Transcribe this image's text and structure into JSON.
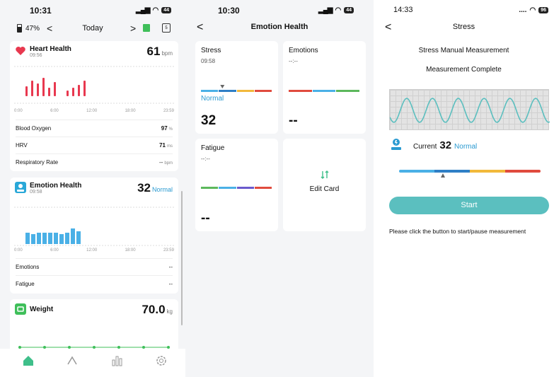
{
  "phone1": {
    "status": {
      "time": "10:31",
      "battery": "44"
    },
    "nav": {
      "battery_pct": "47%",
      "prev": "<",
      "title": "Today",
      "next": ">",
      "cal_day": "5"
    },
    "heart": {
      "title": "Heart Health",
      "time": "09:56",
      "value": "61",
      "unit": "bpm",
      "bars": [
        14,
        22,
        18,
        26,
        12,
        20,
        8,
        12,
        16,
        22
      ],
      "time_labels": [
        "0:00",
        "6:00",
        "12:00",
        "18:00",
        "23:59"
      ],
      "rows": [
        {
          "label": "Blood Oxygen",
          "value": "97",
          "unit": "%"
        },
        {
          "label": "HRV",
          "value": "71",
          "unit": "ms"
        },
        {
          "label": "Respiratory Rate",
          "value": "--",
          "unit": "bpm"
        }
      ]
    },
    "emotion": {
      "title": "Emotion Health",
      "time": "09:58",
      "value": "32",
      "status": "Normal",
      "bars": [
        16,
        14,
        16,
        16,
        16,
        16,
        14,
        16,
        22,
        18
      ],
      "time_labels": [
        "0:00",
        "6:00",
        "12:00",
        "18:00",
        "23:59"
      ],
      "rows": [
        {
          "label": "Emotions",
          "value": "--"
        },
        {
          "label": "Fatigue",
          "value": "--"
        }
      ]
    },
    "weight": {
      "title": "Weight",
      "value": "70.0",
      "unit": "kg"
    },
    "tabs": [
      "home-icon",
      "activity-icon",
      "stats-icon",
      "settings-icon"
    ]
  },
  "phone2": {
    "status": {
      "time": "10:30",
      "battery": "44"
    },
    "header": {
      "back": "<",
      "title": "Emotion Health"
    },
    "tiles": {
      "stress": {
        "title": "Stress",
        "time": "09:58",
        "status": "Normal",
        "value": "32",
        "level": 0.3
      },
      "emotions": {
        "title": "Emotions",
        "time": "--:--",
        "value": "--"
      },
      "fatigue": {
        "title": "Fatigue",
        "time": "--:--",
        "value": "--"
      },
      "edit": {
        "label": "Edit Card"
      }
    }
  },
  "phone3": {
    "status": {
      "time": "14:33",
      "battery": "96"
    },
    "header": {
      "back": "<",
      "title": "Stress"
    },
    "subtitle": "Stress Manual Measurement",
    "complete": "Measurement Complete",
    "current_label": "Current",
    "current_value": "32",
    "current_status": "Normal",
    "level": 0.31,
    "start": "Start",
    "hint": "Please click the button to start/pause measurement"
  },
  "colors": {
    "bar_blue": "#4ab0e6",
    "bar_darkblue": "#2f7fc6",
    "bar_yellow": "#f2b93b",
    "bar_red": "#e04b3e",
    "bar_green": "#5cb85c",
    "bar_purple": "#6a5acd",
    "teal": "#5bbfbf",
    "heart": "#e8384f"
  }
}
